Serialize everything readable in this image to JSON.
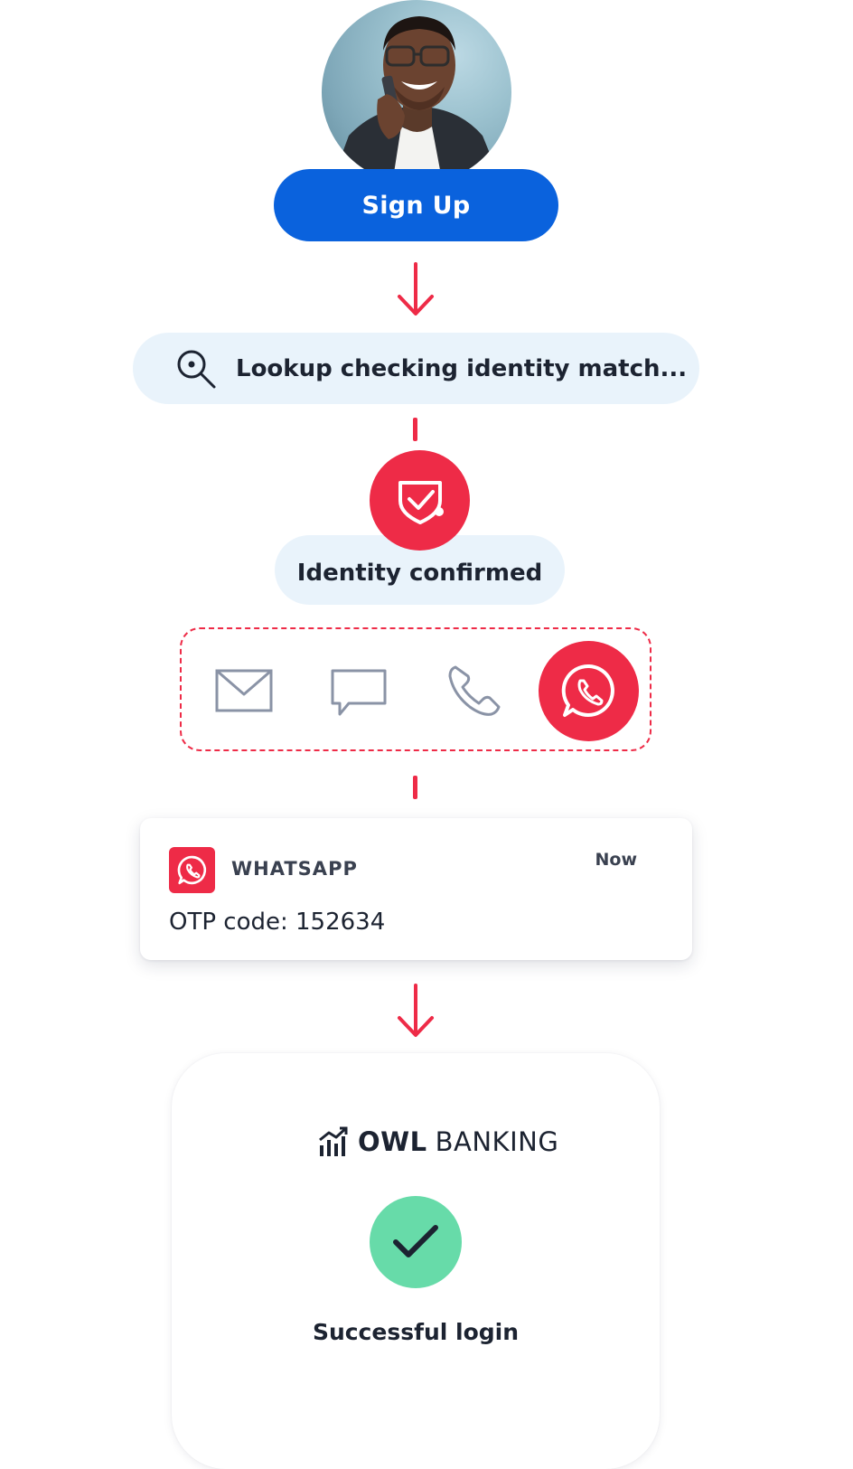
{
  "signup": {
    "label": "Sign Up"
  },
  "lookup": {
    "label": "Lookup checking identity match...",
    "icon": "search-icon"
  },
  "identity": {
    "label": "Identity confirmed",
    "icon": "shield-check-icon"
  },
  "channels": {
    "items": [
      {
        "name": "email-icon"
      },
      {
        "name": "chat-bubble-icon"
      },
      {
        "name": "phone-icon"
      },
      {
        "name": "whatsapp-icon",
        "selected": true
      }
    ]
  },
  "notification": {
    "app_name": "WHATSAPP",
    "time": "Now",
    "message": "OTP code: 152634"
  },
  "bank": {
    "brand_bold": "OWL",
    "brand_light": "BANKING",
    "status": "Successful login"
  },
  "colors": {
    "primary_blue": "#0a62dd",
    "accent_red": "#ee2b47",
    "pill_bg": "#e9f3fb",
    "success_green": "#67dba9",
    "text_dark": "#1c2331"
  }
}
